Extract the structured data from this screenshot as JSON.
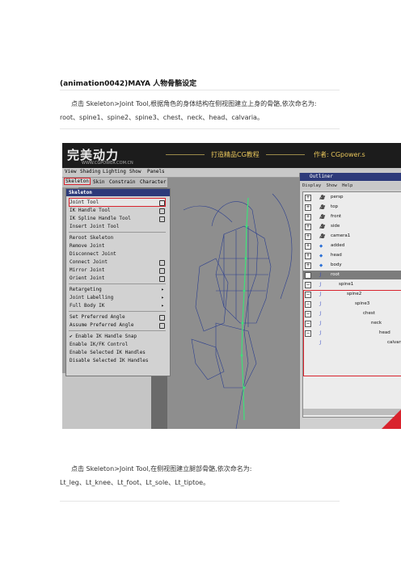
{
  "doc": {
    "title": "(animation0042)MAYA 人物骨骼设定",
    "para1_line1": "点击 Skeleton>Joint Tool,根据角色的身体结构在侧视图建立上身的骨骼,依次命名为:",
    "para1_line2": "root、spine1、spine2、spine3、chest、neck、head、calvaria。",
    "para2_line1": "点击 Skeleton>Joint Tool,在侧视图建立腿部骨骼,依次命名为:",
    "para2_line2": "Lt_leg、Lt_knee、Lt_foot、Lt_sole、Lt_tiptoe。"
  },
  "screenshot": {
    "logo": "完美动力",
    "logo_url": "WWW.CGPOWER.COM.CN",
    "banner_center": "打造精品CG教程",
    "banner_right": "作者: CGpower.s",
    "menubar": [
      "View",
      "Shading",
      "Lighting",
      "Show",
      "Panels"
    ],
    "tabs": [
      "Skeleton",
      "Skin",
      "Constrain",
      "Character"
    ],
    "menu": {
      "header": "Skeleton",
      "items": [
        {
          "label": "Joint Tool",
          "option": true
        },
        {
          "label": "IK Handle Tool",
          "option": true
        },
        {
          "label": "IK Spline Handle Tool",
          "option": true
        },
        {
          "label": "Insert Joint Tool",
          "option": false
        },
        {
          "label": "Reroot Skeleton",
          "option": false
        },
        {
          "label": "Remove Joint",
          "option": false
        },
        {
          "label": "Disconnect Joint",
          "option": false
        },
        {
          "label": "Connect Joint",
          "option": true
        },
        {
          "label": "Mirror Joint",
          "option": true
        },
        {
          "label": "Orient Joint",
          "option": true
        },
        {
          "label": "Retargeting",
          "submenu": true
        },
        {
          "label": "Joint Labelling",
          "submenu": true
        },
        {
          "label": "Full Body IK",
          "submenu": true
        },
        {
          "label": "Set Preferred Angle",
          "option": true
        },
        {
          "label": "Assume Preferred Angle",
          "option": true
        },
        {
          "label": "✔ Enable IK Handle Snap",
          "option": false
        },
        {
          "label": "Enable IK/FK Control",
          "option": false
        },
        {
          "label": "Enable Selected IK Handles",
          "option": false
        },
        {
          "label": "Disable Selected IK Handles",
          "option": false
        }
      ]
    },
    "outliner": {
      "title": "Outliner",
      "menu": [
        "Display",
        "Show",
        "Help"
      ],
      "rows": [
        "persp",
        "top",
        "front",
        "side",
        "camera1",
        "added",
        "head",
        "body",
        "root",
        "spine1",
        "spine2",
        "spine3",
        "chest",
        "neck",
        "head",
        "calvaria"
      ]
    },
    "colors": {
      "highlight": "#d9232d",
      "title_bar": "#2d3a7a",
      "banner_text": "#e7c55a"
    }
  }
}
